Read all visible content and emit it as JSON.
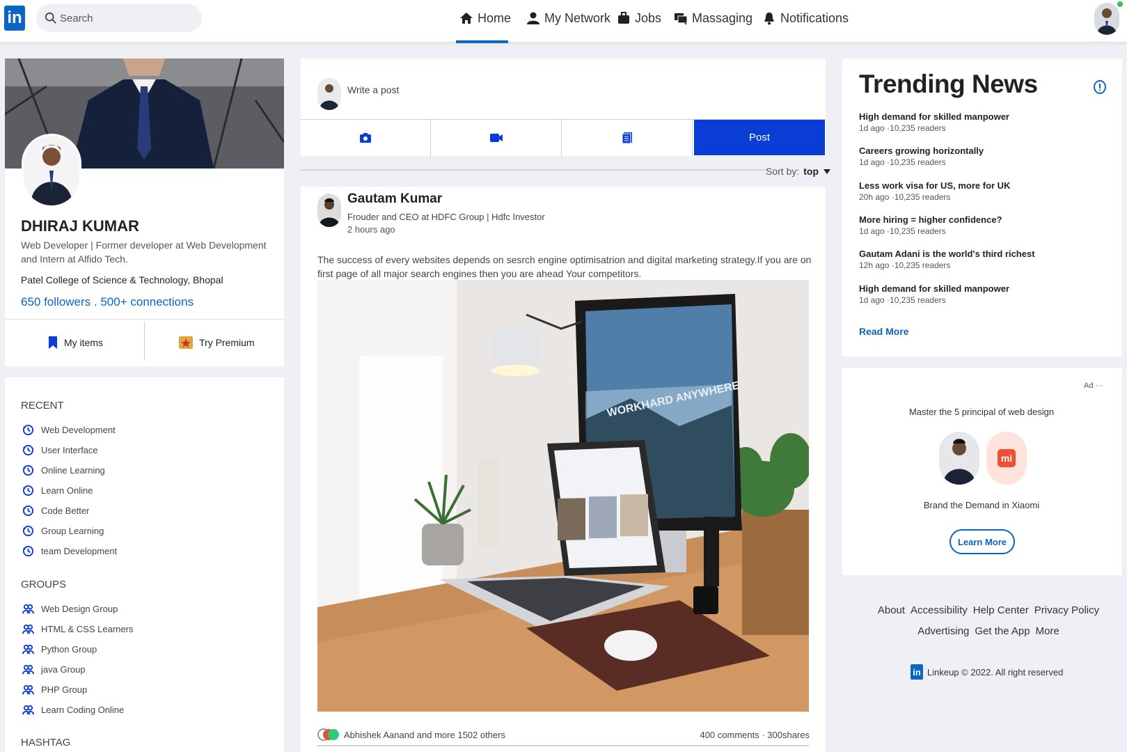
{
  "nav": {
    "logo": "in",
    "search_placeholder": "Search",
    "items": [
      {
        "label": "Home"
      },
      {
        "label": "My Network"
      },
      {
        "label": "Jobs"
      },
      {
        "label": "Massaging"
      },
      {
        "label": "Notifications"
      }
    ]
  },
  "profile": {
    "name": "DHIRAJ KUMAR",
    "bio": "Web Developer | Former developer at Web Development and Intern at Alfido Tech.",
    "college": "Patel College of Science & Technology, Bhopal",
    "followers": "650 followers",
    "connections": "500+ connections",
    "my_items": "My items",
    "try_premium": "Try Premium"
  },
  "sidebar": {
    "recent_title": "RECENT",
    "recent": [
      "Web Development",
      "User Interface",
      "Online Learning",
      "Learn Online",
      "Code Better",
      "Group Learning",
      "team Development"
    ],
    "groups_title": "GROUPS",
    "groups": [
      "Web Design Group",
      "HTML & CSS Learners",
      "Python Group",
      "java Group",
      "PHP Group",
      "Learn Coding Online"
    ],
    "hashtag_title": "HASHTAG"
  },
  "composer": {
    "placeholder": "Write a post",
    "post_label": "Post"
  },
  "sort": {
    "label": "Sort by:",
    "value": "top"
  },
  "post": {
    "author": "Gautam Kumar",
    "headline": "Frouder and CEO at HDFC Group | Hdfc Investor",
    "time": "2 hours ago",
    "text": "The success of every websites depends on sesrch engine optimisatrion and digital marketing strategy.If you are on first page of all major search engines then you are ahead Your competitors.",
    "image_caption": "WORKHARD ANYWHERE",
    "reactions": "Abhishek Aanand and more 1502 others",
    "stats": "400 comments · 300shares"
  },
  "trending": {
    "title": "Trending News",
    "items": [
      {
        "headline": "High demand for skilled manpower",
        "meta": "1d ago ·10,235 readers"
      },
      {
        "headline": "Careers growing horizontally",
        "meta": "1d ago ·10,235 readers"
      },
      {
        "headline": "Less work visa for US, more for UK",
        "meta": "20h ago ·10,235 readers"
      },
      {
        "headline": "More hiring = higher confidence?",
        "meta": "1d ago ·10,235 readers"
      },
      {
        "headline": "Gautam Adani is the world's third richest",
        "meta": "12h ago ·10,235 readers"
      },
      {
        "headline": "High demand for skilled manpower",
        "meta": "1d ago ·10,235 readers"
      }
    ],
    "read_more": "Read More"
  },
  "ad": {
    "label": "Ad ···",
    "text": "Master the 5 principal of web design",
    "brand_logo": "mi",
    "caption": "Brand the Demand in Xiaomi",
    "button": "Learn More"
  },
  "footer": {
    "row1": [
      "About",
      "Accessibility",
      "Help Center",
      "Privacy Policy"
    ],
    "row2": [
      "Advertising",
      "Get the App",
      "More"
    ],
    "copyright": "Linkeup © 2022. All right reserved"
  },
  "colors": {
    "brand": "#0a66c2",
    "post_button": "#0a3cd6",
    "background": "#eef0f5"
  }
}
